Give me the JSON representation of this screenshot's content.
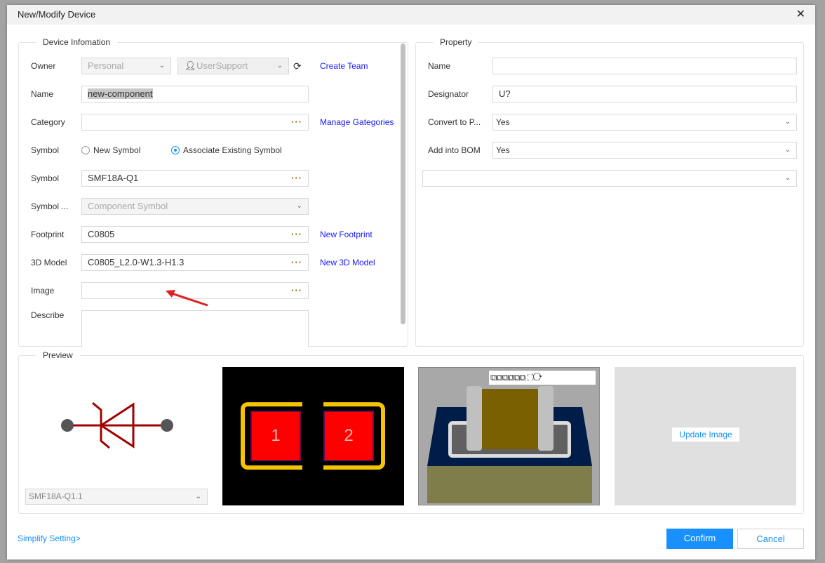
{
  "dialog": {
    "title": "New/Modify Device"
  },
  "device_info": {
    "legend": "Device Infomation",
    "owner": {
      "label": "Owner",
      "personal": "Personal",
      "user": "UserSupport",
      "create_team": "Create Team"
    },
    "name": {
      "label": "Name",
      "value": "new-component"
    },
    "category": {
      "label": "Category",
      "value": "",
      "manage": "Manage Gategories"
    },
    "symbol_mode": {
      "label": "Symbol",
      "options": [
        "New Symbol",
        "Associate Existing Symbol"
      ],
      "selected": "Associate Existing Symbol"
    },
    "symbol": {
      "label": "Symbol",
      "value": "SMF18A-Q1"
    },
    "symbol_type": {
      "label": "Symbol ...",
      "value": "Component Symbol"
    },
    "footprint": {
      "label": "Footprint",
      "value": "C0805",
      "new": "New Footprint"
    },
    "model3d": {
      "label": "3D Model",
      "value": "C0805_L2.0-W1.3-H1.3",
      "new": "New 3D Model"
    },
    "image": {
      "label": "Image",
      "value": ""
    },
    "describe": {
      "label": "Describe",
      "value": ""
    },
    "more": "···"
  },
  "property": {
    "legend": "Property",
    "name": {
      "label": "Name",
      "value": ""
    },
    "designator": {
      "label": "Designator",
      "value": "U?"
    },
    "convert": {
      "label": "Convert to P...",
      "value": "Yes"
    },
    "bom": {
      "label": "Add into BOM",
      "value": "Yes"
    },
    "extra": {
      "value": ""
    }
  },
  "preview": {
    "legend": "Preview",
    "symbol_select": "SMF18A-Q1.1",
    "pads": [
      "1",
      "2"
    ],
    "update_image": "Update Image"
  },
  "footer": {
    "simplify": "Simplify Setting>",
    "confirm": "Confirm",
    "cancel": "Cancel"
  },
  "colors": {
    "accent": "#1890ff",
    "link": "#1a1aff",
    "symbol": "#a00000",
    "pad": "#ff0000",
    "pad_ring": "#f5c400"
  }
}
